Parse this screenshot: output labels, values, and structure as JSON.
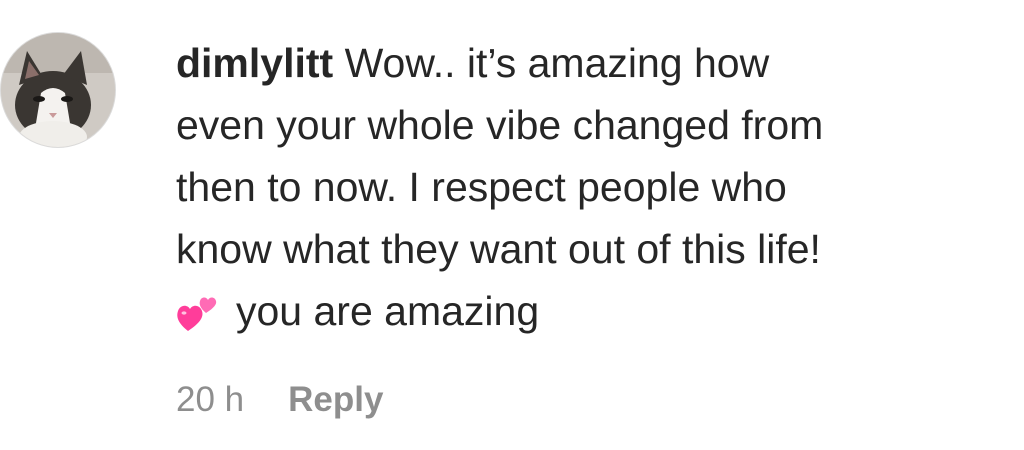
{
  "comment": {
    "username": "dimlylitt",
    "text_lines": [
      "Wow.. it’s amazing how",
      "even your whole vibe changed from",
      "then to now. I respect people who",
      "know what they want out of this life!"
    ],
    "emoji_icon": "two-hearts-icon",
    "last_line": "you are amazing",
    "timestamp": "20 h",
    "reply_label": "Reply"
  },
  "colors": {
    "text": "#262626",
    "meta": "#8e8e8e",
    "heart": "#ff4fa3"
  }
}
